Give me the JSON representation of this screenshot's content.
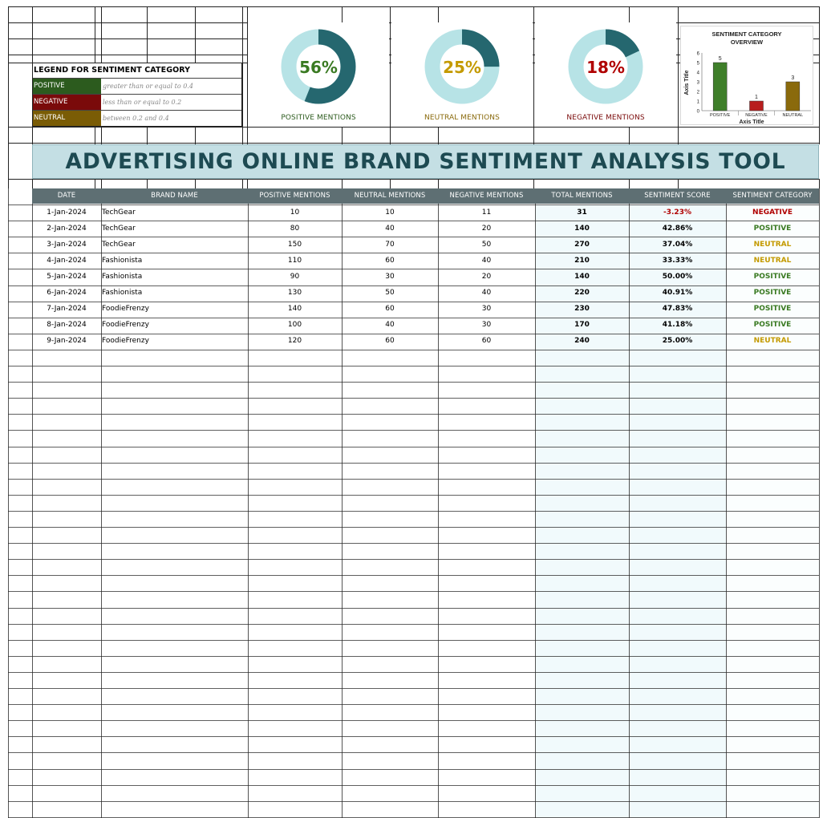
{
  "colors": {
    "positive": "#2c5b1e",
    "negative": "#7a0a0a",
    "neutral": "#7a5c05",
    "donut_dark": "#25676f",
    "donut_light": "#b7e3e6",
    "positive_text": "#3a7a22",
    "negative_text": "#b00000",
    "neutral_text": "#c49a00",
    "header_bg": "#5e6f73",
    "banner_bg": "#c4dfe4"
  },
  "legend": {
    "title": "LEGEND FOR SENTIMENT CATEGORY",
    "items": [
      {
        "label": "POSITIVE",
        "desc": "greater than or equal to 0.4"
      },
      {
        "label": "NEGATIVE",
        "desc": "less than or equal to 0.2"
      },
      {
        "label": "NEUTRAL",
        "desc": "between 0.2 and 0.4"
      }
    ]
  },
  "donuts": [
    {
      "pct_text": "56%",
      "value": 0.56,
      "label": "POSITIVE MENTIONS"
    },
    {
      "pct_text": "25%",
      "value": 0.25,
      "label": "NEUTRAL MENTIONS"
    },
    {
      "pct_text": "18%",
      "value": 0.18,
      "label": "NEGATIVE MENTIONS"
    }
  ],
  "chart_data": {
    "type": "bar",
    "title": "SENTIMENT CATEGORY OVERVIEW",
    "title_line1": "SENTIMENT CATEGORY",
    "title_line2": "OVERVIEW",
    "categories": [
      "POSITIVE",
      "NEGATIVE",
      "NEUTRAL"
    ],
    "values": [
      5,
      1,
      3
    ],
    "bar_colors": [
      "#3f7f2a",
      "#b81d1d",
      "#8a6a0c"
    ],
    "xlabel": "Axis Title",
    "ylabel": "Axis Title",
    "ylim": [
      0,
      6
    ],
    "yticks": [
      "0",
      "1",
      "2",
      "3",
      "4",
      "5",
      "6"
    ],
    "grid": false
  },
  "title": "ADVERTISING ONLINE BRAND SENTIMENT ANALYSIS TOOL",
  "table": {
    "headers": [
      "DATE",
      "BRAND NAME",
      "POSITIVE MENTIONS",
      "NEUTRAL MENTIONS",
      "NEGATIVE MENTIONS",
      "TOTAL MENTIONS",
      "SENTIMENT SCORE",
      "SENTIMENT CATEGORY"
    ],
    "rows": [
      {
        "date": "1-Jan-2024",
        "brand": "TechGear",
        "pos": "10",
        "neu": "10",
        "neg": "11",
        "total": "31",
        "score": "-3.23%",
        "cat": "NEGATIVE"
      },
      {
        "date": "2-Jan-2024",
        "brand": "TechGear",
        "pos": "80",
        "neu": "40",
        "neg": "20",
        "total": "140",
        "score": "42.86%",
        "cat": "POSITIVE"
      },
      {
        "date": "3-Jan-2024",
        "brand": "TechGear",
        "pos": "150",
        "neu": "70",
        "neg": "50",
        "total": "270",
        "score": "37.04%",
        "cat": "NEUTRAL"
      },
      {
        "date": "4-Jan-2024",
        "brand": "Fashionista",
        "pos": "110",
        "neu": "60",
        "neg": "40",
        "total": "210",
        "score": "33.33%",
        "cat": "NEUTRAL"
      },
      {
        "date": "5-Jan-2024",
        "brand": "Fashionista",
        "pos": "90",
        "neu": "30",
        "neg": "20",
        "total": "140",
        "score": "50.00%",
        "cat": "POSITIVE"
      },
      {
        "date": "6-Jan-2024",
        "brand": "Fashionista",
        "pos": "130",
        "neu": "50",
        "neg": "40",
        "total": "220",
        "score": "40.91%",
        "cat": "POSITIVE"
      },
      {
        "date": "7-Jan-2024",
        "brand": "FoodieFrenzy",
        "pos": "140",
        "neu": "60",
        "neg": "30",
        "total": "230",
        "score": "47.83%",
        "cat": "POSITIVE"
      },
      {
        "date": "8-Jan-2024",
        "brand": "FoodieFrenzy",
        "pos": "100",
        "neu": "40",
        "neg": "30",
        "total": "170",
        "score": "41.18%",
        "cat": "POSITIVE"
      },
      {
        "date": "9-Jan-2024",
        "brand": "FoodieFrenzy",
        "pos": "120",
        "neu": "60",
        "neg": "60",
        "total": "240",
        "score": "25.00%",
        "cat": "NEUTRAL"
      }
    ]
  }
}
